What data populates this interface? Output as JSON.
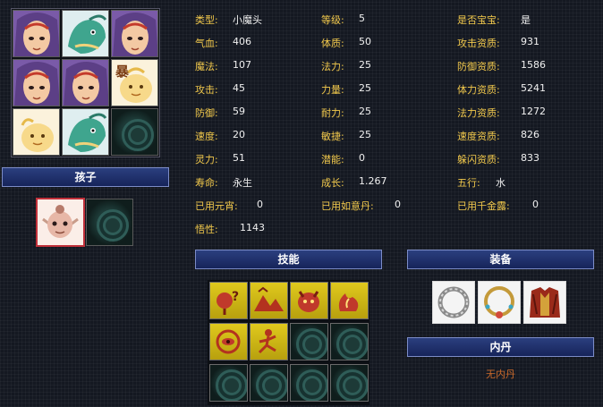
{
  "pets": {
    "slots": [
      {
        "icon": "demon-boy-portrait"
      },
      {
        "icon": "green-dragon-portrait"
      },
      {
        "icon": "demon-boy-portrait"
      },
      {
        "icon": "demon-boy-portrait"
      },
      {
        "icon": "demon-boy-portrait"
      },
      {
        "icon": "bao-spirit-portrait",
        "badge": "暴"
      },
      {
        "icon": "bao-spirit-portrait"
      },
      {
        "icon": "green-dragon-portrait"
      },
      {
        "icon": "empty-slot"
      }
    ]
  },
  "child_section": {
    "title": "孩子",
    "slots": [
      {
        "icon": "elf-child-portrait"
      },
      {
        "icon": "empty-slot"
      }
    ]
  },
  "stats": {
    "col1": [
      {
        "label": "类型:",
        "value": "小魔头"
      },
      {
        "label": "气血:",
        "value": "406"
      },
      {
        "label": "魔法:",
        "value": "107"
      },
      {
        "label": "攻击:",
        "value": "45"
      },
      {
        "label": "防御:",
        "value": "59"
      },
      {
        "label": "速度:",
        "value": "20"
      },
      {
        "label": "灵力:",
        "value": "51"
      },
      {
        "label": "寿命:",
        "value": "永生"
      },
      {
        "label": "已用元宵:",
        "value": "0"
      },
      {
        "label": "悟性:",
        "value": "1143"
      }
    ],
    "col2": [
      {
        "label": "等级:",
        "value": "5"
      },
      {
        "label": "体质:",
        "value": "50"
      },
      {
        "label": "法力:",
        "value": "25"
      },
      {
        "label": "力量:",
        "value": "25"
      },
      {
        "label": "耐力:",
        "value": "25"
      },
      {
        "label": "敏捷:",
        "value": "25"
      },
      {
        "label": "潜能:",
        "value": "0"
      },
      {
        "label": "成长:",
        "value": "1.267"
      },
      {
        "label": "已用如意丹:",
        "value": "0"
      }
    ],
    "col3": [
      {
        "label": "是否宝宝:",
        "value": "是"
      },
      {
        "label": "攻击资质:",
        "value": "931"
      },
      {
        "label": "防御资质:",
        "value": "1586"
      },
      {
        "label": "体力资质:",
        "value": "5241"
      },
      {
        "label": "法力资质:",
        "value": "1272"
      },
      {
        "label": "速度资质:",
        "value": "826"
      },
      {
        "label": "躲闪资质:",
        "value": "833"
      },
      {
        "label": "五行:",
        "value": "水"
      },
      {
        "label": "已用千金露:",
        "value": "0"
      }
    ]
  },
  "skills": {
    "title": "技能",
    "slots": [
      {
        "icon": "unknown-skill-icon",
        "filled": true
      },
      {
        "icon": "mountain-skill-icon",
        "filled": true
      },
      {
        "icon": "demon-face-skill-icon",
        "filled": true
      },
      {
        "icon": "flame-spirit-skill-icon",
        "filled": true
      },
      {
        "icon": "eye-skill-icon",
        "filled": true
      },
      {
        "icon": "runner-skill-icon",
        "filled": true
      },
      {
        "icon": "empty-slot",
        "filled": false
      },
      {
        "icon": "empty-slot",
        "filled": false
      },
      {
        "icon": "empty-slot",
        "filled": false
      },
      {
        "icon": "empty-slot",
        "filled": false
      },
      {
        "icon": "empty-slot",
        "filled": false
      },
      {
        "icon": "empty-slot",
        "filled": false
      }
    ]
  },
  "equipment": {
    "title": "装备",
    "slots": [
      {
        "icon": "silver-ring-icon"
      },
      {
        "icon": "gold-necklace-icon"
      },
      {
        "icon": "red-armor-icon"
      }
    ]
  },
  "inner_dan": {
    "title": "内丹",
    "empty_text": "无内丹"
  },
  "colors": {
    "label": "#f2c94c",
    "value": "#f0f0f0",
    "header_bar": "#2b3f7f",
    "no_dan": "#c9692a"
  }
}
